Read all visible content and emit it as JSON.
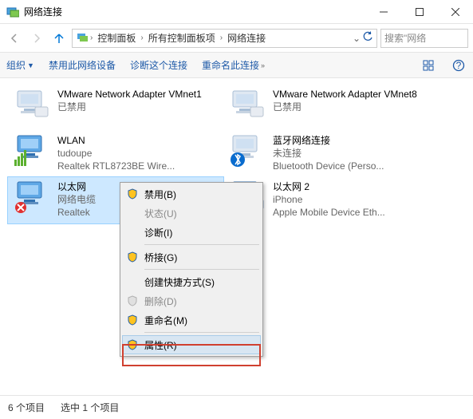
{
  "window": {
    "title": "网络连接"
  },
  "breadcrumb": {
    "a": "控制面板",
    "b": "所有控制面板项",
    "c": "网络连接"
  },
  "search": {
    "placeholder": "搜索\"网络"
  },
  "toolbar": {
    "org": "组织",
    "disable": "禁用此网络设备",
    "diag": "诊断这个连接",
    "rename": "重命名此连接"
  },
  "connections": [
    {
      "name": "VMware Network Adapter VMnet1",
      "l2": "已禁用",
      "l3": ""
    },
    {
      "name": "VMware Network Adapter VMnet8",
      "l2": "已禁用",
      "l3": ""
    },
    {
      "name": "WLAN",
      "l2": "tudoupe",
      "l3": "Realtek RTL8723BE Wire..."
    },
    {
      "name": "蓝牙网络连接",
      "l2": "未连接",
      "l3": "Bluetooth Device (Perso..."
    },
    {
      "name": "以太网",
      "l2": "网络电缆",
      "l3": "Realtek"
    },
    {
      "name": "以太网 2",
      "l2": "iPhone",
      "l3": "Apple Mobile Device Eth..."
    }
  ],
  "menu": {
    "enable": "禁用(B)",
    "status": "状态(U)",
    "diag": "诊断(I)",
    "bridge": "桥接(G)",
    "shortcut": "创建快捷方式(S)",
    "delete": "删除(D)",
    "rename": "重命名(M)",
    "props": "属性(R)"
  },
  "status": {
    "count": "6 个项目",
    "sel": "选中 1 个项目"
  }
}
